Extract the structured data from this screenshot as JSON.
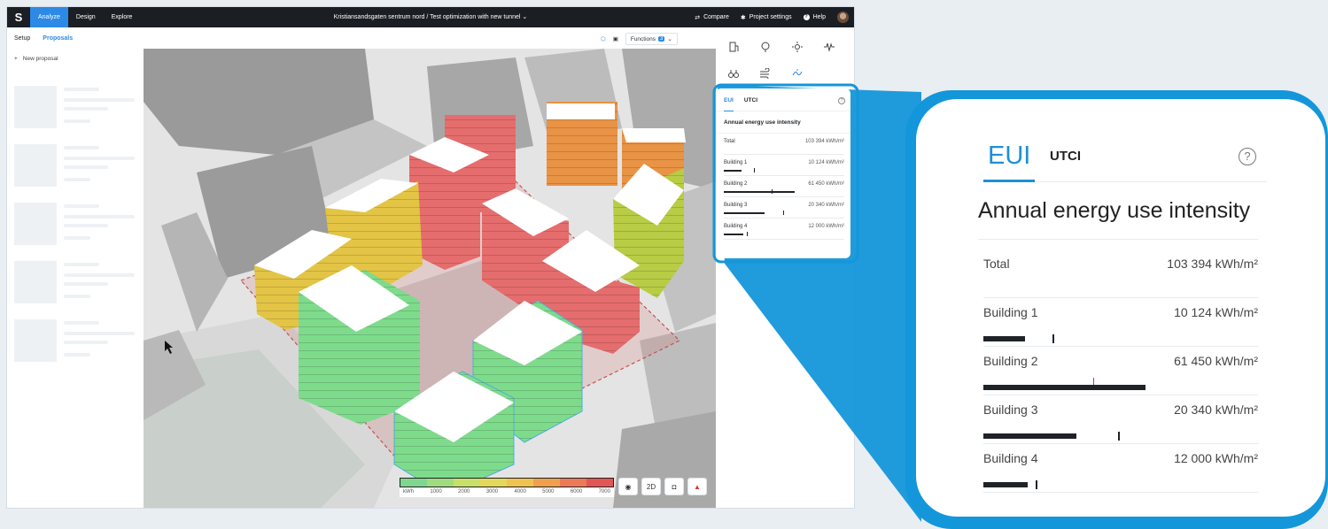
{
  "topbar": {
    "logo": "S",
    "tabs": [
      {
        "label": "Analyze",
        "active": true
      },
      {
        "label": "Design",
        "active": false
      },
      {
        "label": "Explore",
        "active": false
      }
    ],
    "project_title": "Kristiansandsgaten sentrum nord / Test optimization with new tunnel",
    "compare_label": "Compare",
    "project_settings_label": "Project settings",
    "help_label": "Help"
  },
  "left_panel": {
    "tabs": [
      {
        "label": "Setup",
        "active": false
      },
      {
        "label": "Proposals",
        "active": true
      }
    ],
    "new_proposal_label": "New proposal"
  },
  "viewport_tools": {
    "functions_label": "Functions",
    "functions_count": "3"
  },
  "analysis_icons": [
    "building-icon",
    "tree-icon",
    "sun-icon",
    "noise-icon",
    "binoculars-icon",
    "wind-icon",
    "energy-icon"
  ],
  "eui_panel": {
    "tabs": [
      {
        "label": "EUI",
        "active": true
      },
      {
        "label": "UTCI",
        "active": false
      }
    ],
    "help_glyph": "?",
    "heading": "Annual energy use intensity",
    "total": {
      "label": "Total",
      "value": "103 394 kWh/m²"
    },
    "buildings": [
      {
        "label": "Building 1",
        "value": "10 124 kWh/m²",
        "fraction": 0.15,
        "marker": 0.25
      },
      {
        "label": "Building 2",
        "value": "61 450 kWh/m²",
        "fraction": 0.59,
        "marker": 0.4
      },
      {
        "label": "Building 3",
        "value": "20 340 kWh/m²",
        "fraction": 0.34,
        "marker": 0.49
      },
      {
        "label": "Building 4",
        "value": "12 000 kWh/m²",
        "fraction": 0.16,
        "marker": 0.19
      }
    ]
  },
  "legend": {
    "unit": "kWh",
    "ticks": [
      "1000",
      "2000",
      "3000",
      "4000",
      "5000",
      "6000",
      "7000"
    ],
    "colors": [
      "#7fd68f",
      "#9fdc80",
      "#c6e06a",
      "#e5d75a",
      "#f0c24f",
      "#f0a04d",
      "#ec7a56",
      "#e35656"
    ]
  },
  "viewport_controls": {
    "mode_label": "2D"
  },
  "colors": {
    "accent": "#2c8ae6",
    "callout_blue": "#1496da",
    "building_red": "#e56d6d",
    "building_orange": "#e89345",
    "building_yellow": "#e3c445",
    "building_green": "#7edb8c",
    "building_lime": "#b8cc45"
  }
}
